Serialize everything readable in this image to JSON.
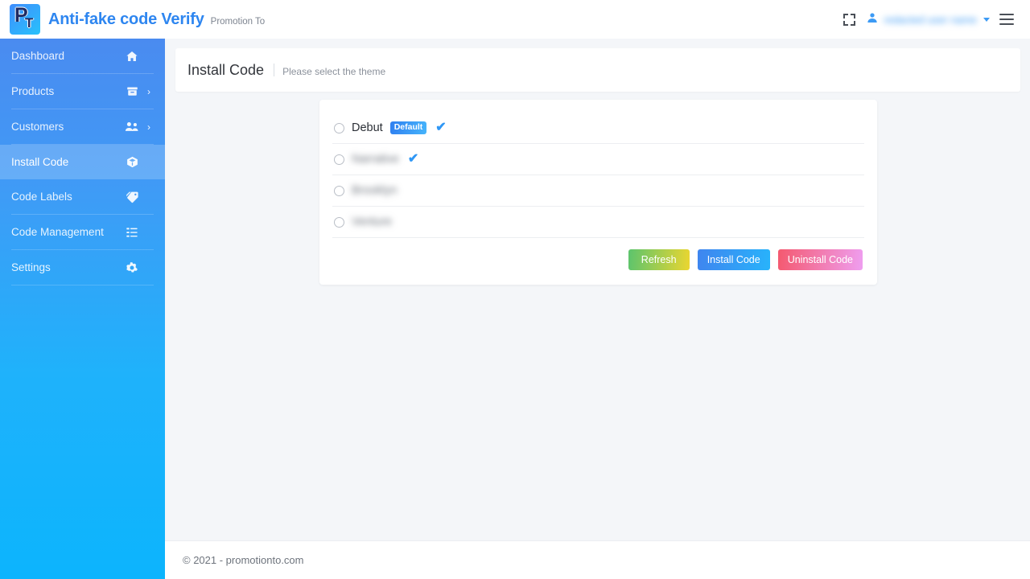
{
  "header": {
    "brand_title": "Anti-fake code Verify",
    "brand_subtitle": "Promotion To",
    "logo_letter_p": "P",
    "logo_letter_t": "T",
    "fullscreen_icon": "fullscreen-icon",
    "user_icon": "user-icon",
    "user_name": "redacted user name",
    "caret_icon": "chevron-down-icon",
    "menu_icon": "hamburger-menu-icon"
  },
  "sidebar": {
    "items": [
      {
        "label": "Dashboard",
        "icon": "home-icon",
        "has_arrow": false,
        "active": false
      },
      {
        "label": "Products",
        "icon": "archive-box-icon",
        "has_arrow": true,
        "active": false
      },
      {
        "label": "Customers",
        "icon": "users-icon",
        "has_arrow": true,
        "active": false
      },
      {
        "label": "Install Code",
        "icon": "cube-icon",
        "has_arrow": false,
        "active": true
      },
      {
        "label": "Code Labels",
        "icon": "tag-icon",
        "has_arrow": false,
        "active": false
      },
      {
        "label": "Code Management",
        "icon": "list-icon",
        "has_arrow": false,
        "active": false
      },
      {
        "label": "Settings",
        "icon": "gear-icon",
        "has_arrow": false,
        "active": false
      }
    ],
    "arrow_glyph": "›"
  },
  "page": {
    "title": "Install Code",
    "subtitle": "Please select the theme"
  },
  "themes": {
    "rows": [
      {
        "name": "Debut",
        "blurred": false,
        "badge": "Default",
        "installed": true
      },
      {
        "name": "Narrative",
        "blurred": true,
        "badge": null,
        "installed": true
      },
      {
        "name": "Brooklyn",
        "blurred": true,
        "badge": null,
        "installed": false
      },
      {
        "name": "Venture",
        "blurred": true,
        "badge": null,
        "installed": false
      }
    ],
    "check_glyph": "✔"
  },
  "buttons": {
    "refresh": "Refresh",
    "install": "Install Code",
    "uninstall": "Uninstall Code"
  },
  "colors": {
    "brand_blue": "#2e86f0",
    "accent_check": "#2f97f5",
    "sidebar_top": "#4a8bf0",
    "sidebar_bottom": "#0cb4fd",
    "page_bg": "#f4f6f9"
  },
  "footer": {
    "copyright": "© 2021 - promotionto.com"
  }
}
